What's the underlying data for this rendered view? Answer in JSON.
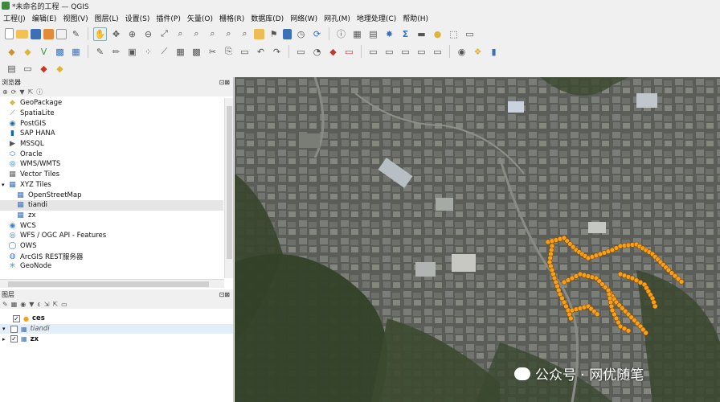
{
  "window": {
    "title": "*未命名的工程 — QGIS"
  },
  "menu": [
    "工程(J)",
    "编辑(E)",
    "视图(V)",
    "图层(L)",
    "设置(S)",
    "插件(P)",
    "矢量(O)",
    "栅格(R)",
    "数据库(D)",
    "网络(W)",
    "网孔(M)",
    "地理处理(C)",
    "帮助(H)"
  ],
  "browser": {
    "title": "浏览器",
    "items": [
      {
        "label": "GeoPackage",
        "icon": "geopackage-icon",
        "color": "#e0b43c"
      },
      {
        "label": "SpatiaLite",
        "icon": "spatialite-icon",
        "color": "#5c7fb8"
      },
      {
        "label": "PostGIS",
        "icon": "postgis-icon",
        "color": "#336791"
      },
      {
        "label": "SAP HANA",
        "icon": "hana-icon",
        "color": "#1a5fb4"
      },
      {
        "label": "MSSQL",
        "icon": "mssql-icon",
        "color": "#555"
      },
      {
        "label": "Oracle",
        "icon": "oracle-icon",
        "color": "#3a6fb5"
      },
      {
        "label": "WMS/WMTS",
        "icon": "wms-icon",
        "color": "#3a7bd5"
      },
      {
        "label": "Vector Tiles",
        "icon": "vector-tiles-icon",
        "color": "#666"
      },
      {
        "label": "XYZ Tiles",
        "icon": "xyz-tiles-icon",
        "color": "#3a6fb5"
      },
      {
        "label": "OpenStreetMap",
        "icon": "xyz-tiles-icon",
        "color": "#3a6fb5"
      },
      {
        "label": "tiandi",
        "icon": "xyz-tiles-icon",
        "color": "#3a6fb5"
      },
      {
        "label": "zx",
        "icon": "xyz-tiles-icon",
        "color": "#3a6fb5"
      },
      {
        "label": "WCS",
        "icon": "wcs-icon",
        "color": "#3a7bd5"
      },
      {
        "label": "WFS / OGC API - Features",
        "icon": "wfs-icon",
        "color": "#3a7bd5"
      },
      {
        "label": "OWS",
        "icon": "ows-icon",
        "color": "#3a7bd5"
      },
      {
        "label": "ArcGIS REST服务器",
        "icon": "arcgis-icon",
        "color": "#3a7bd5"
      },
      {
        "label": "GeoNode",
        "icon": "geonode-icon",
        "color": "#3a7bd5"
      }
    ]
  },
  "layers": {
    "title": "图层",
    "items": [
      {
        "name": "ces",
        "checked": true
      },
      {
        "name": "tiandi",
        "checked": false
      },
      {
        "name": "zx",
        "checked": true
      }
    ]
  },
  "map": {
    "point_color": "#f5a11c"
  },
  "watermark": "公众号 · 网优随笔"
}
